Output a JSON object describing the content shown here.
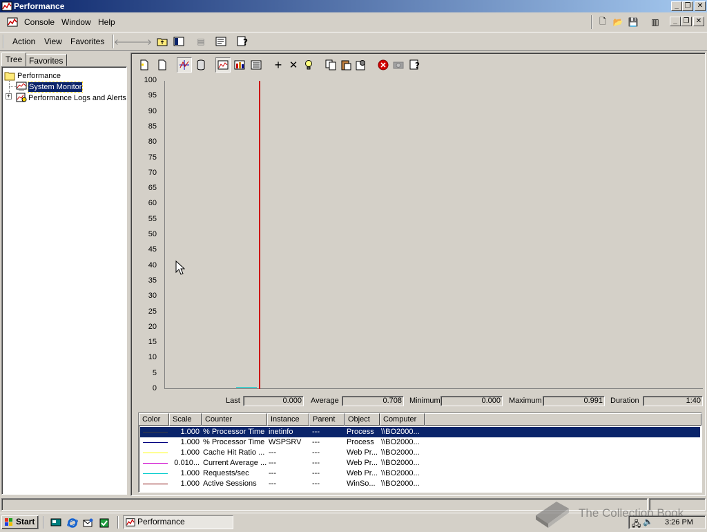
{
  "window": {
    "title": "Performance",
    "caption_buttons": {
      "minimize": "_",
      "restore": "❐",
      "close": "✕"
    }
  },
  "menubar": {
    "items": [
      {
        "label": "Console",
        "icon": "console-icon"
      },
      {
        "label": "Window"
      },
      {
        "label": "Help"
      }
    ]
  },
  "actionbar": {
    "items": [
      {
        "label": "Action"
      },
      {
        "label": "View"
      },
      {
        "label": "Favorites"
      }
    ]
  },
  "left_pane": {
    "tabs": [
      {
        "label": "Tree",
        "active": true
      },
      {
        "label": "Favorites",
        "active": false
      }
    ],
    "tree": [
      {
        "label": "Performance",
        "icon": "folder-icon"
      },
      {
        "label": "System Monitor",
        "icon": "system-monitor-icon",
        "selected": true
      },
      {
        "label": "Performance Logs and Alerts",
        "icon": "logs-alerts-icon",
        "expander": "+"
      }
    ]
  },
  "graph": {
    "y_ticks": [
      "100",
      "95",
      "90",
      "85",
      "80",
      "75",
      "70",
      "65",
      "60",
      "55",
      "50",
      "45",
      "40",
      "35",
      "30",
      "25",
      "20",
      "15",
      "10",
      "5",
      "0"
    ],
    "time_bar_fraction": 0.175,
    "time_bar_color": "#cc0000"
  },
  "stats": {
    "last_label": "Last",
    "last_value": "0.000",
    "average_label": "Average",
    "average_value": "0.708",
    "minimum_label": "Minimum",
    "minimum_value": "0.000",
    "maximum_label": "Maximum",
    "maximum_value": "0.991",
    "duration_label": "Duration",
    "duration_value": "1:40"
  },
  "counter_list": {
    "columns": [
      "Color",
      "Scale",
      "Counter",
      "Instance",
      "Parent",
      "Object",
      "Computer"
    ],
    "rows": [
      {
        "color": "#404040",
        "scale": "1.000",
        "counter": "% Processor Time",
        "instance": "inetinfo",
        "parent": "---",
        "object": "Process",
        "computer": "\\\\BO2000...",
        "selected": true
      },
      {
        "color": "#000080",
        "scale": "1.000",
        "counter": "% Processor Time",
        "instance": "WSPSRV",
        "parent": "---",
        "object": "Process",
        "computer": "\\\\BO2000..."
      },
      {
        "color": "#ffff00",
        "scale": "1.000",
        "counter": "Cache Hit Ratio ...",
        "instance": "---",
        "parent": "---",
        "object": "Web Pr...",
        "computer": "\\\\BO2000..."
      },
      {
        "color": "#cc00cc",
        "scale": "0.010...",
        "counter": "Current Average ...",
        "instance": "---",
        "parent": "---",
        "object": "Web Pr...",
        "computer": "\\\\BO2000..."
      },
      {
        "color": "#00cccc",
        "scale": "1.000",
        "counter": "Requests/sec",
        "instance": "---",
        "parent": "---",
        "object": "Web Pr...",
        "computer": "\\\\BO2000..."
      },
      {
        "color": "#800000",
        "scale": "1.000",
        "counter": "Active Sessions",
        "instance": "---",
        "parent": "---",
        "object": "WinSo...",
        "computer": "\\\\BO2000..."
      }
    ]
  },
  "taskbar": {
    "start_label": "Start",
    "task_label": "Performance",
    "clock": "3:26 PM"
  },
  "watermark": "The Collection Book"
}
